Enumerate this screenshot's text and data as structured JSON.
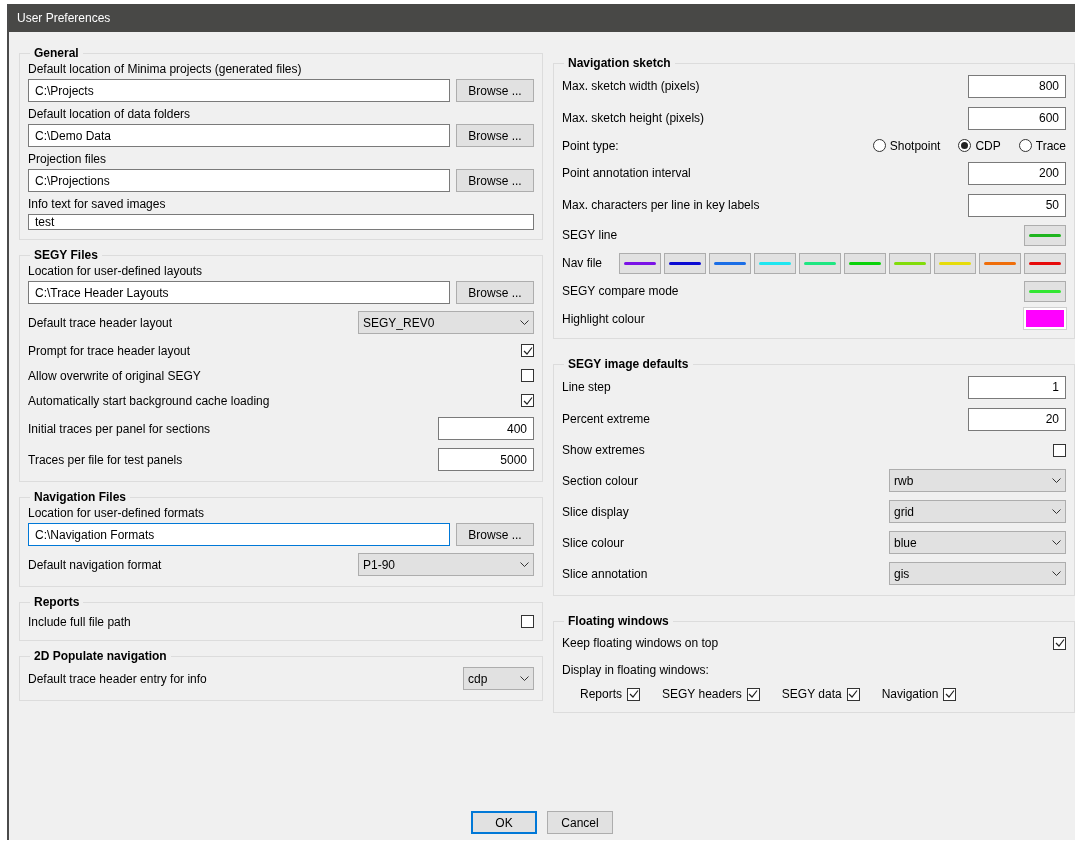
{
  "window": {
    "title": "User Preferences"
  },
  "left_sections": [
    {
      "title": "General",
      "rows": [
        {
          "kind": "path",
          "label": "Default location of Minima projects (generated files)",
          "value": "C:\\Projects",
          "button": "Browse ...",
          "focused": false
        },
        {
          "kind": "path",
          "label": "Default location of data folders",
          "value": "C:\\Demo Data",
          "button": "Browse ...",
          "focused": false
        },
        {
          "kind": "path",
          "label": "Projection files",
          "value": "C:\\Projections",
          "button": "Browse ...",
          "focused": false
        },
        {
          "kind": "text",
          "label": "Info text for saved images",
          "value": "test"
        }
      ]
    },
    {
      "title": "SEGY Files",
      "rows": [
        {
          "kind": "path",
          "label": "Location for user-defined layouts",
          "value": "C:\\Trace Header Layouts",
          "button": "Browse ...",
          "focused": false
        },
        {
          "kind": "select",
          "label": "Default trace header layout",
          "value": "SEGY_REV0"
        },
        {
          "kind": "checkbox",
          "label": "Prompt for trace header layout",
          "checked": true
        },
        {
          "kind": "checkbox",
          "label": "Allow overwrite of original SEGY",
          "checked": false
        },
        {
          "kind": "checkbox",
          "label": "Automatically start background cache loading",
          "checked": true
        },
        {
          "kind": "number",
          "label": "Initial traces per panel for sections",
          "value": "400"
        },
        {
          "kind": "number",
          "label": "Traces per file for test panels",
          "value": "5000"
        }
      ]
    },
    {
      "title": "Navigation Files",
      "rows": [
        {
          "kind": "path",
          "label": "Location for user-defined formats",
          "value": "C:\\Navigation Formats",
          "button": "Browse ...",
          "focused": true
        },
        {
          "kind": "select",
          "label": "Default navigation format",
          "value": "P1-90"
        }
      ]
    },
    {
      "title": "Reports",
      "rows": [
        {
          "kind": "checkbox",
          "label": "Include full file path",
          "checked": false
        }
      ]
    },
    {
      "title": "2D Populate navigation",
      "rows": [
        {
          "kind": "short_select",
          "label": "Default trace header entry for info",
          "value": "cdp"
        }
      ]
    }
  ],
  "right_sections": [
    {
      "title": "Navigation sketch",
      "rows": [
        {
          "kind": "number",
          "label": "Max. sketch width (pixels)",
          "value": "800"
        },
        {
          "kind": "number",
          "label": "Max. sketch height (pixels)",
          "value": "600"
        },
        {
          "kind": "radio",
          "label": "Point type:",
          "options": [
            {
              "label": "Shotpoint",
              "selected": false
            },
            {
              "label": "CDP",
              "selected": true
            },
            {
              "label": "Trace",
              "selected": false
            }
          ]
        },
        {
          "kind": "number",
          "label": "Point annotation interval",
          "value": "200"
        },
        {
          "kind": "number",
          "label": "Max. characters per line in key labels",
          "value": "50"
        },
        {
          "kind": "color",
          "label": "SEGY line",
          "color": "#1eb41e"
        },
        {
          "kind": "palette",
          "label": "Nav file",
          "colors": [
            {
              "color": "#7a12e6"
            },
            {
              "color": "#0a0ad2"
            },
            {
              "color": "#1a6ee6"
            },
            {
              "color": "#1ee6f0"
            },
            {
              "color": "#1ee682"
            },
            {
              "color": "#0ad20a"
            },
            {
              "color": "#82dc0a"
            },
            {
              "color": "#e6dc0a"
            },
            {
              "color": "#ef6e0a"
            },
            {
              "color": "#e60a0a"
            }
          ]
        },
        {
          "kind": "color",
          "label": "SEGY compare mode",
          "color": "#32e632"
        },
        {
          "kind": "swatch",
          "label": "Highlight colour",
          "color": "#ff00ff"
        }
      ]
    },
    {
      "title": "SEGY image defaults",
      "rows": [
        {
          "kind": "number",
          "label": "Line step",
          "value": "1"
        },
        {
          "kind": "number",
          "label": "Percent extreme",
          "value": "20"
        },
        {
          "kind": "checkbox",
          "label": "Show extremes",
          "checked": false
        },
        {
          "kind": "select",
          "label": "Section colour",
          "value": "rwb"
        },
        {
          "kind": "select",
          "label": "Slice display",
          "value": "grid"
        },
        {
          "kind": "select",
          "label": "Slice colour",
          "value": "blue"
        },
        {
          "kind": "select",
          "label": "Slice annotation",
          "value": "gis"
        }
      ]
    },
    {
      "title": "Floating windows",
      "rows": [
        {
          "kind": "checkbox",
          "label": "Keep floating windows on top",
          "checked": true
        },
        {
          "kind": "note",
          "label": "Display in floating windows:"
        },
        {
          "kind": "checklist",
          "items": [
            {
              "label": "Reports",
              "checked": true
            },
            {
              "label": "SEGY headers",
              "checked": true
            },
            {
              "label": "SEGY data",
              "checked": true
            },
            {
              "label": "Navigation",
              "checked": true
            }
          ]
        }
      ]
    }
  ],
  "buttons": [
    {
      "label": "OK",
      "default": true
    },
    {
      "label": "Cancel",
      "default": false
    }
  ]
}
